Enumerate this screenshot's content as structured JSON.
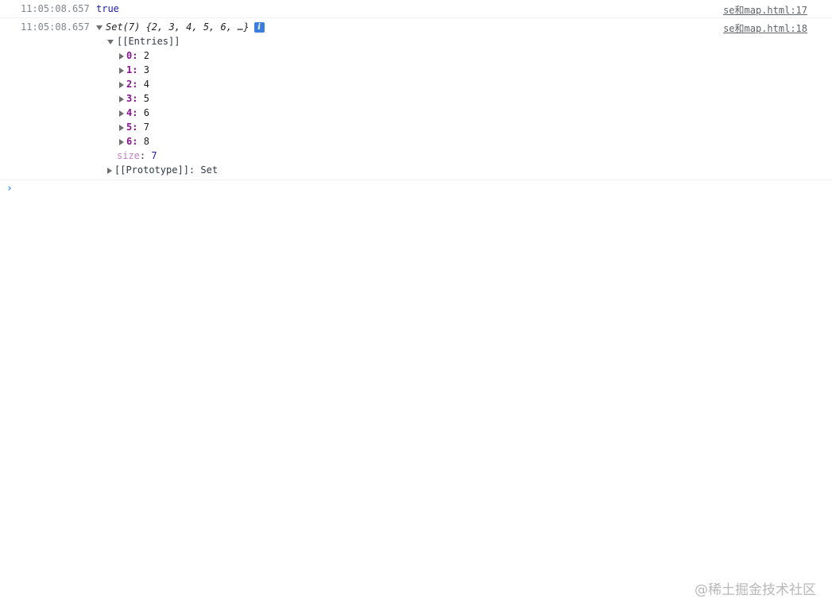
{
  "log1": {
    "timestamp": "11:05:08.657",
    "value": "true",
    "source": "se和map.html:17"
  },
  "log2": {
    "timestamp": "11:05:08.657",
    "summary_prefix": "Set(7) ",
    "summary_values": "{2, 3, 4, 5, 6, …}",
    "source": "se和map.html:18",
    "entries_label": "[[Entries]]",
    "entries": [
      {
        "key": "0",
        "value": "2"
      },
      {
        "key": "1",
        "value": "3"
      },
      {
        "key": "2",
        "value": "4"
      },
      {
        "key": "3",
        "value": "5"
      },
      {
        "key": "4",
        "value": "6"
      },
      {
        "key": "5",
        "value": "7"
      },
      {
        "key": "6",
        "value": "8"
      }
    ],
    "size_key": "size",
    "size_value": "7",
    "prototype_label": "[[Prototype]]",
    "prototype_value": "Set"
  },
  "icons": {
    "info": "info-icon",
    "prompt": "chevron-right-icon"
  },
  "prompt_glyph": "›",
  "watermark": "@稀土掘金技术社区",
  "colors": {
    "key": "#881391",
    "number": "#1a1aa6",
    "link": "#5f6368",
    "info": "#3b7ddd",
    "prompt": "#3a8ee6"
  }
}
